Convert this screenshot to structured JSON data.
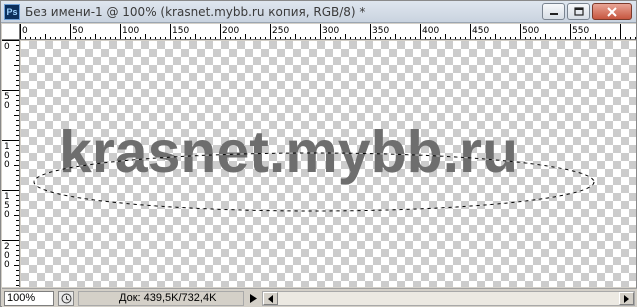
{
  "window": {
    "app_icon": "Ps",
    "title": "Без имени-1 @ 100% (krasnet.mybb.ru копия, RGB/8) *"
  },
  "rulers": {
    "horizontal_labels": [
      "0",
      "50",
      "100",
      "150",
      "200",
      "250",
      "300",
      "350",
      "400",
      "450",
      "500",
      "550"
    ],
    "vertical_labels": [
      "0",
      "5\n0",
      "1\n0\n0",
      "1\n5\n0",
      "2\n0\n0"
    ]
  },
  "canvas": {
    "text_layer": "krasnet.mybb.ru",
    "text_color": "#6e6e6e",
    "selection_shape": "ellipse-marquee"
  },
  "statusbar": {
    "zoom": "100%",
    "doc_info": "Док: 439,5K/732,4K"
  },
  "icons": {
    "minimize": "minimize-icon",
    "maximize": "maximize-icon",
    "close": "close-icon",
    "status": "status-info-icon",
    "menu_arrow": "play-arrow-icon",
    "scroll_left": "scroll-left-icon",
    "scroll_right": "scroll-right-icon"
  }
}
